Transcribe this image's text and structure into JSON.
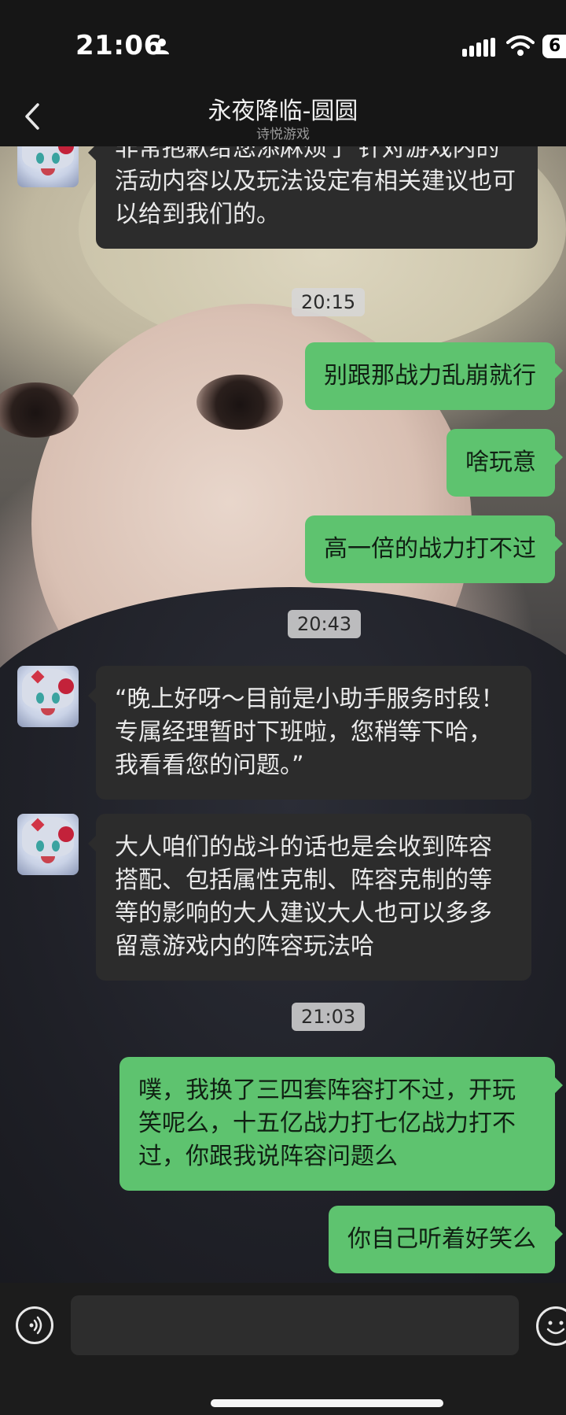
{
  "status_bar": {
    "time": "21:06",
    "battery": "6"
  },
  "header": {
    "title": "永夜降临-圆圆",
    "subtitle": "诗悦游戏"
  },
  "messages": [
    {
      "from": "them",
      "text": "非常抱歉给您添麻烦了 针对游戏内的活动内容以及玩法设定有相关建议也可以给到我们的。"
    },
    {
      "timestamp": "20:15"
    },
    {
      "from": "me",
      "text": "别跟那战力乱崩就行"
    },
    {
      "from": "me",
      "text": "啥玩意"
    },
    {
      "from": "me",
      "text": "高一倍的战力打不过"
    },
    {
      "timestamp": "20:43"
    },
    {
      "from": "them",
      "text": "“晚上好呀～目前是小助手服务时段！专属经理暂时下班啦，您稍等下哈，我看看您的问题。”"
    },
    {
      "from": "them",
      "text": "大人咱们的战斗的话也是会收到阵容搭配、包括属性克制、阵容克制的等等的影响的大人建议大人也可以多多留意游戏内的阵容玩法哈"
    },
    {
      "timestamp": "21:03"
    },
    {
      "from": "me",
      "text": "噗，我换了三四套阵容打不过，开玩笑呢么，十五亿战力打七亿战力打不过，你跟我说阵容问题么"
    },
    {
      "from": "me",
      "text": "你自己听着好笑么"
    }
  ],
  "input": {
    "value": "",
    "placeholder": ""
  },
  "colors": {
    "outgoing_bubble": "#5ec36f",
    "incoming_bubble": "#2c2c2c",
    "header_bg": "#161616"
  }
}
